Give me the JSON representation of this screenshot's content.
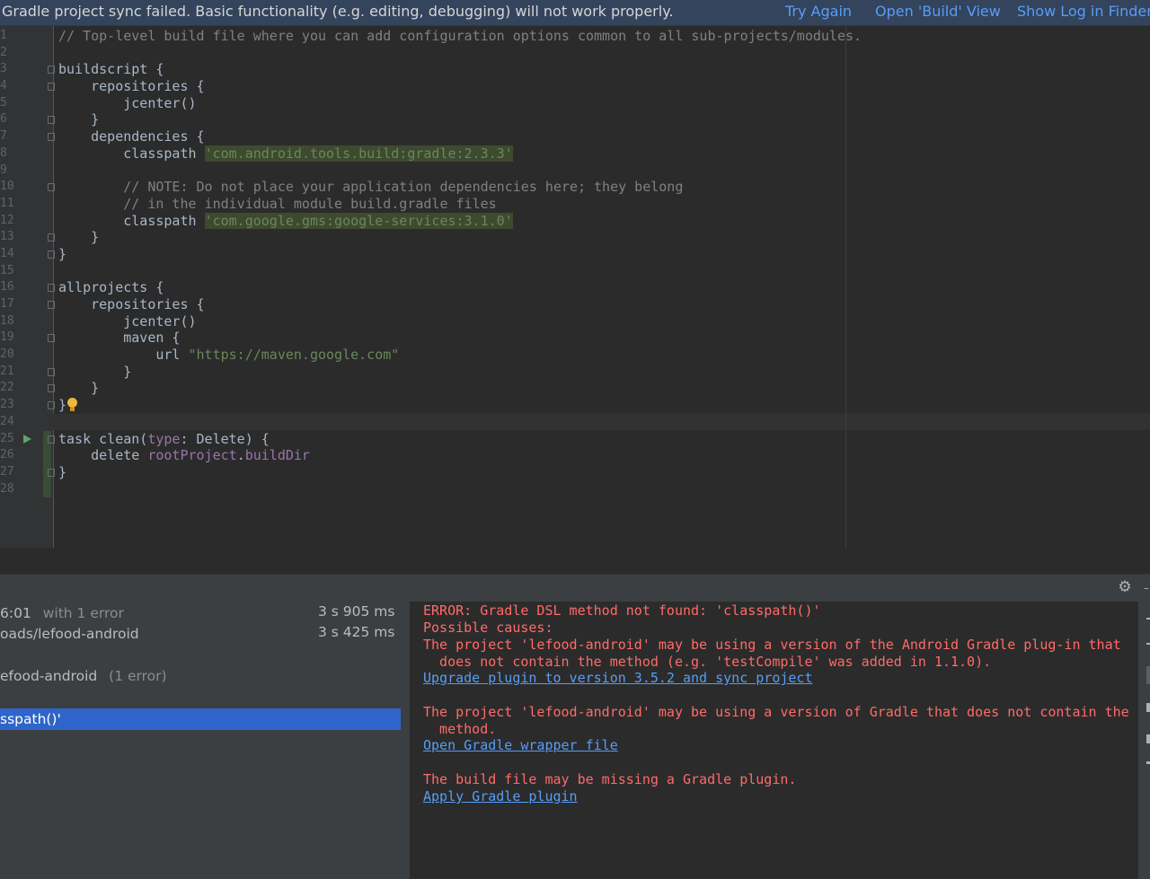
{
  "notification": {
    "message": "Gradle project sync failed. Basic functionality (e.g. editing, debugging) will not work properly.",
    "try_again": "Try Again",
    "open_build": "Open 'Build' View",
    "show_log": "Show Log in Finder"
  },
  "editor": {
    "lines": [
      {
        "n": "1",
        "segs": [
          {
            "t": "// Top-level build file where you can add configuration options common to all sub-projects/modules.",
            "c": "cmt"
          }
        ]
      },
      {
        "n": "2",
        "segs": []
      },
      {
        "n": "3",
        "segs": [
          {
            "t": "buildscript {",
            "c": ""
          }
        ],
        "fold": true
      },
      {
        "n": "4",
        "segs": [
          {
            "t": "    repositories {",
            "c": ""
          }
        ],
        "fold": true
      },
      {
        "n": "5",
        "segs": [
          {
            "t": "        jcenter()",
            "c": ""
          }
        ]
      },
      {
        "n": "6",
        "segs": [
          {
            "t": "    }",
            "c": ""
          }
        ],
        "fold": true
      },
      {
        "n": "7",
        "segs": [
          {
            "t": "    dependencies {",
            "c": ""
          }
        ],
        "fold": true
      },
      {
        "n": "8",
        "segs": [
          {
            "t": "        classpath ",
            "c": ""
          },
          {
            "t": "'com.android.tools.build:gradle:2.3.3'",
            "c": "str"
          }
        ]
      },
      {
        "n": "9",
        "segs": []
      },
      {
        "n": "10",
        "segs": [
          {
            "t": "        // NOTE: Do not place your application dependencies here; they belong",
            "c": "cmt"
          }
        ],
        "fold": true
      },
      {
        "n": "11",
        "segs": [
          {
            "t": "        // in the individual module build.gradle files",
            "c": "cmt"
          }
        ]
      },
      {
        "n": "12",
        "segs": [
          {
            "t": "        classpath ",
            "c": ""
          },
          {
            "t": "'com.google.gms:google-services:3.1.0'",
            "c": "str"
          }
        ]
      },
      {
        "n": "13",
        "segs": [
          {
            "t": "    }",
            "c": ""
          }
        ],
        "fold": true
      },
      {
        "n": "14",
        "segs": [
          {
            "t": "}",
            "c": ""
          }
        ],
        "fold": true
      },
      {
        "n": "15",
        "segs": []
      },
      {
        "n": "16",
        "segs": [
          {
            "t": "allprojects {",
            "c": ""
          }
        ],
        "fold": true
      },
      {
        "n": "17",
        "segs": [
          {
            "t": "    repositories {",
            "c": ""
          }
        ],
        "fold": true
      },
      {
        "n": "18",
        "segs": [
          {
            "t": "        jcenter()",
            "c": ""
          }
        ]
      },
      {
        "n": "19",
        "segs": [
          {
            "t": "        maven {",
            "c": ""
          }
        ],
        "fold": true
      },
      {
        "n": "20",
        "segs": [
          {
            "t": "            url ",
            "c": ""
          },
          {
            "t": "\"https://maven.google.com\"",
            "c": "str2"
          }
        ]
      },
      {
        "n": "21",
        "segs": [
          {
            "t": "        }",
            "c": ""
          }
        ],
        "fold": true
      },
      {
        "n": "22",
        "segs": [
          {
            "t": "    }",
            "c": ""
          }
        ],
        "fold": true
      },
      {
        "n": "23",
        "segs": [
          {
            "t": "}",
            "c": ""
          }
        ],
        "fold": true,
        "bulb": true
      },
      {
        "n": "24",
        "segs": []
      },
      {
        "n": "25",
        "segs": [
          {
            "t": "task clean(",
            "c": ""
          },
          {
            "t": "type",
            "c": "named"
          },
          {
            "t": ": Delete) {",
            "c": ""
          }
        ],
        "fold": true,
        "run": true
      },
      {
        "n": "26",
        "segs": [
          {
            "t": "    delete ",
            "c": ""
          },
          {
            "t": "rootProject",
            "c": "named"
          },
          {
            "t": ".",
            "c": ""
          },
          {
            "t": "buildDir",
            "c": "named"
          }
        ]
      },
      {
        "n": "27",
        "segs": [
          {
            "t": "}",
            "c": ""
          }
        ],
        "fold": true
      },
      {
        "n": "28",
        "segs": []
      }
    ]
  },
  "build_tree": {
    "row1_label": "6:01",
    "row1_suffix": "with 1 error",
    "row1_time": "3 s 905 ms",
    "row2_label": "oads/lefood-android",
    "row2_time": "3 s 425 ms",
    "row3_label": "efood-android",
    "row3_suffix": "(1 error)",
    "selected_label": "sspath()'"
  },
  "console": {
    "error_line": "ERROR: Gradle DSL method not found: 'classpath()'",
    "possible_causes": "Possible causes:",
    "cause1_line1": "The project 'lefood-android' may be using a version of the Android Gradle plug-in that",
    "cause1_line2": "  does not contain the method (e.g. 'testCompile' was added in 1.1.0).",
    "link1": "Upgrade plugin to version 3.5.2 and sync project",
    "cause2_line1": "The project 'lefood-android' may be using a version of Gradle that does not contain the",
    "cause2_line2": "  method.",
    "link2": "Open Gradle wrapper file",
    "cause3_line1": "The build file may be missing a Gradle plugin.",
    "link3": "Apply Gradle plugin"
  },
  "icons": {
    "gear": "settings-gear",
    "run": "run-triangle",
    "bulb": "intention-bulb"
  },
  "colors": {
    "error": "#ff6b68",
    "link": "#589df6",
    "selection": "#2f65ca",
    "notification_bg": "#33445c"
  }
}
